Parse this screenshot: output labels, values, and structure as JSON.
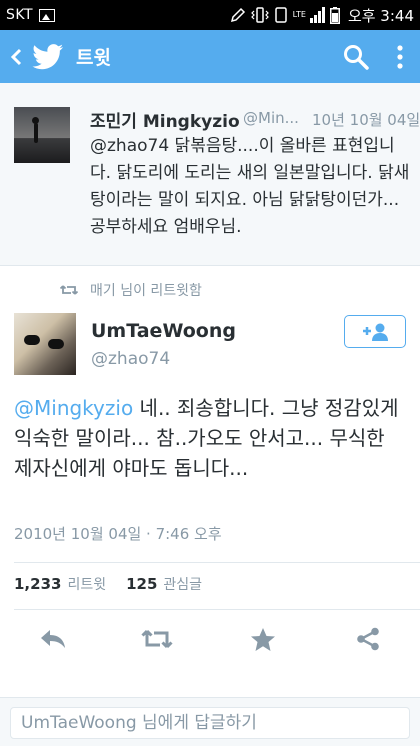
{
  "status_bar": {
    "carrier": "SKT",
    "network": "LTE",
    "time": "오후 3:44"
  },
  "action_bar": {
    "title": "트윗",
    "back_icon": "back-chevron-icon",
    "logo_icon": "twitter-bird-icon",
    "search_icon": "search-icon",
    "more_icon": "overflow-menu-icon"
  },
  "parent_tweet": {
    "name": "조민기 Mingkyzio",
    "handle": "@Min...",
    "date": "10년 10월 04일",
    "text": "@zhao74 닭볶음탕....이 올바른 표현입니다. 닭도리에 도리는 새의 일본말입니다. 닭새탕이라는 말이 되지요. 아님 닭닭탕이던가... 공부하세요 엄배우님."
  },
  "retweet_context": {
    "text": "매기 님이 리트윗함"
  },
  "main_tweet": {
    "name": "UmTaeWoong",
    "handle": "@zhao74",
    "mention": "@Mingkyzio",
    "text": " 네.. 죄송합니다.  그냥 정감있게 익숙한 말이라... 참..가오도 안서고... 무식한 제자신에게 야마도 돕니다...",
    "timestamp": "2010년 10월 04일 · 7:46 오후",
    "retweets_count": "1,233",
    "retweets_label": "리트윗",
    "favorites_count": "125",
    "favorites_label": "관심글"
  },
  "reply": {
    "placeholder": "UmTaeWoong 님에게 답글하기"
  },
  "colors": {
    "brand": "#55acee",
    "text": "#292f33",
    "muted": "#8899a6",
    "border": "#e1e8ed"
  }
}
